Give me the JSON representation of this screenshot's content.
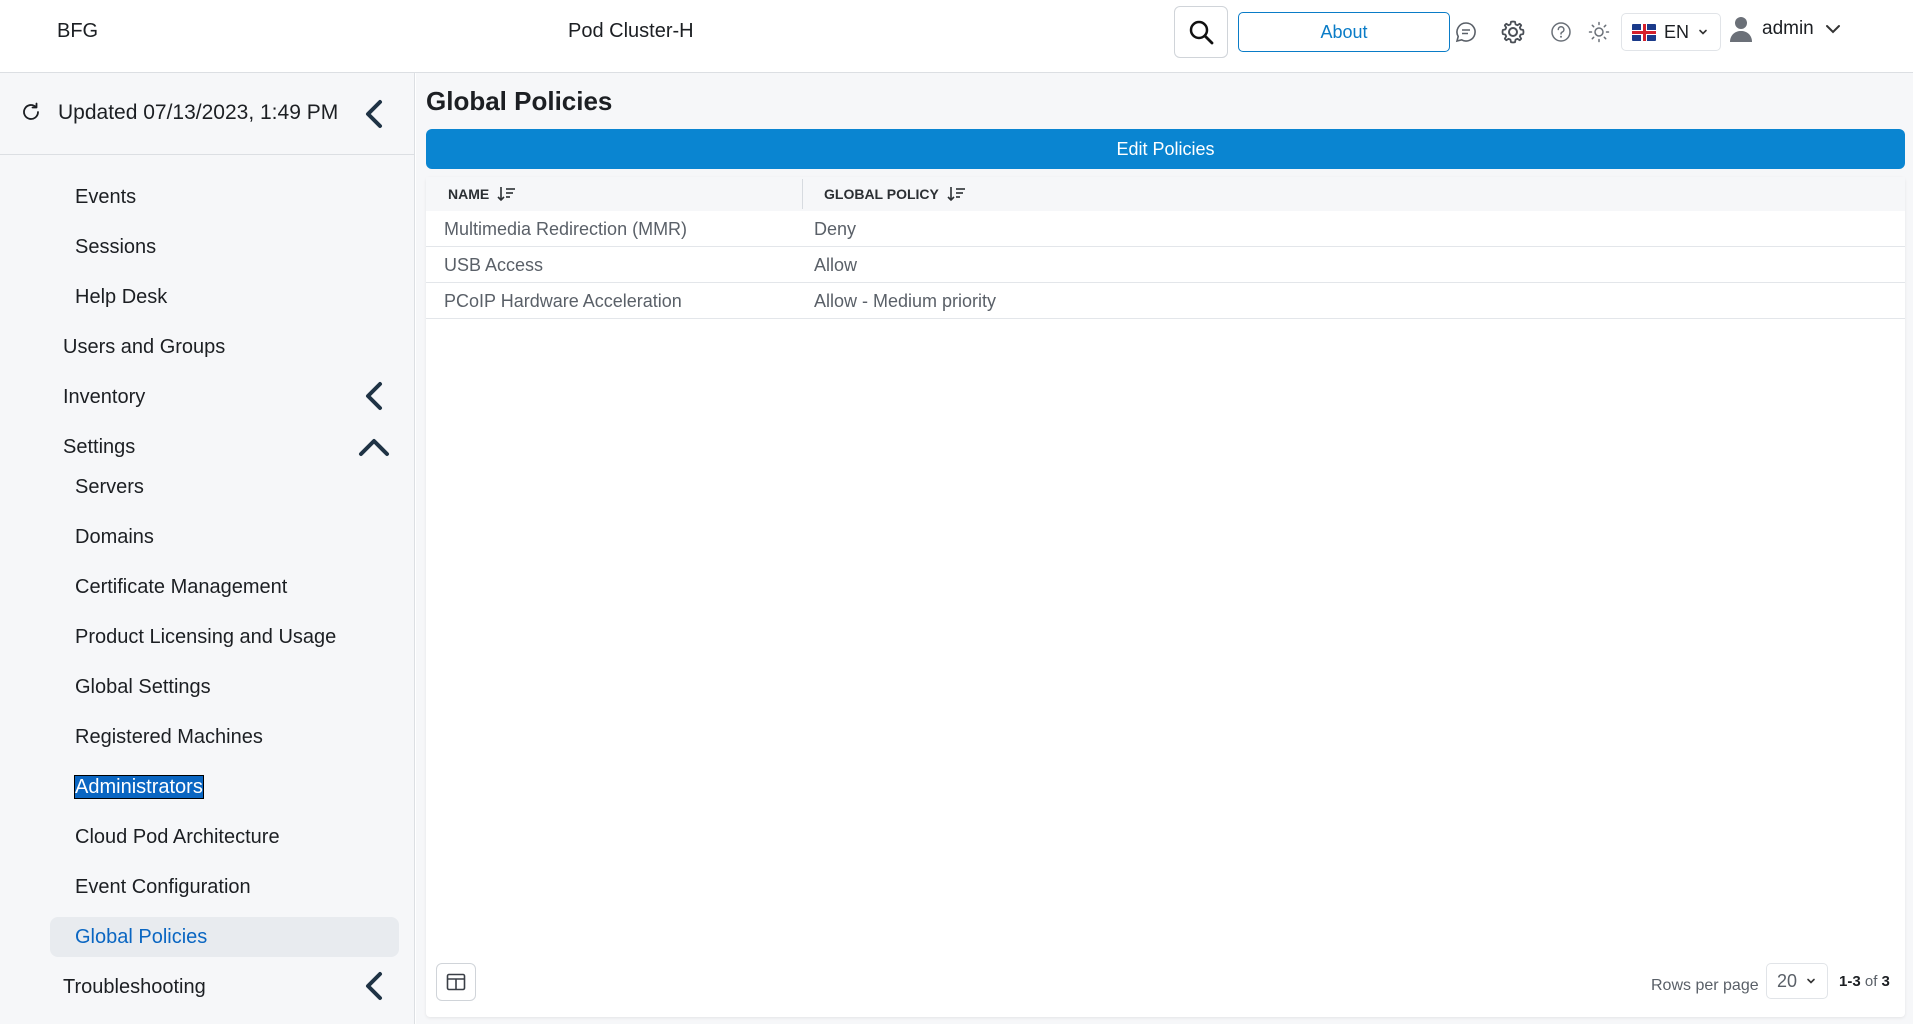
{
  "header": {
    "brand": "BFG",
    "cluster": "Pod Cluster-H",
    "about_label": "About",
    "language": "EN",
    "user": "admin",
    "icons": [
      "search-icon",
      "chat-icon",
      "gear-icon",
      "help-icon",
      "sun-icon",
      "uk-flag-icon",
      "user-icon"
    ]
  },
  "sidebar": {
    "updated": "Updated 07/13/2023, 1:49 PM",
    "items": [
      {
        "label": "Events"
      },
      {
        "label": "Sessions"
      },
      {
        "label": "Help Desk"
      },
      {
        "label": "Users and Groups"
      },
      {
        "label": "Inventory"
      },
      {
        "label": "Settings"
      },
      {
        "label": "Servers"
      },
      {
        "label": "Domains"
      },
      {
        "label": "Certificate Management"
      },
      {
        "label": "Product Licensing and Usage"
      },
      {
        "label": "Global Settings"
      },
      {
        "label": "Registered Machines"
      },
      {
        "label": "Administrators"
      },
      {
        "label": "Cloud Pod Architecture"
      },
      {
        "label": "Event Configuration"
      },
      {
        "label": "Global Policies"
      },
      {
        "label": "Troubleshooting"
      }
    ]
  },
  "main": {
    "title": "Global Policies",
    "edit_label": "Edit Policies",
    "columns": [
      "NAME",
      "GLOBAL POLICY"
    ],
    "rows": [
      {
        "name": "Multimedia Redirection (MMR)",
        "policy": "Deny"
      },
      {
        "name": "USB Access",
        "policy": "Allow"
      },
      {
        "name": "PCoIP Hardware Acceleration",
        "policy": "Allow - Medium priority"
      }
    ],
    "pager": {
      "rows_label": "Rows per page",
      "rows_value": "20",
      "range": "1-3",
      "of": "of",
      "total": "3"
    }
  },
  "colors": {
    "accent": "#0a85d1",
    "link_active": "#0a66c2"
  }
}
